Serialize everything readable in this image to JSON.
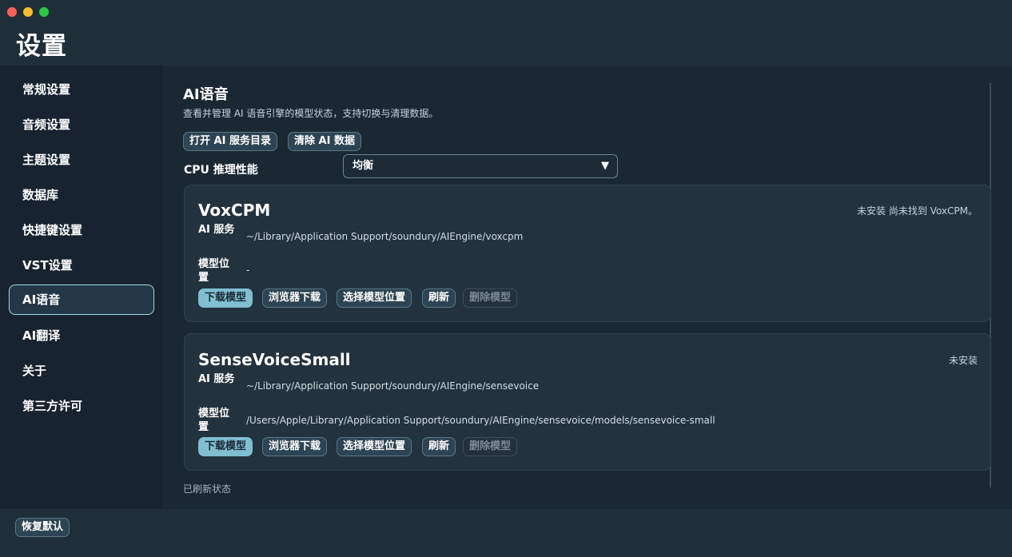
{
  "window": {
    "title": "设置"
  },
  "sidebar": {
    "items": [
      {
        "label": "常规设置"
      },
      {
        "label": "音频设置"
      },
      {
        "label": "主题设置"
      },
      {
        "label": "数据库"
      },
      {
        "label": "快捷键设置"
      },
      {
        "label": "VST设置"
      },
      {
        "label": "AI语音",
        "active": true
      },
      {
        "label": "AI翻译"
      },
      {
        "label": "关于"
      },
      {
        "label": "第三方许可"
      }
    ]
  },
  "section": {
    "title": "AI语音",
    "description": "查看并管理 AI 语音引擎的模型状态，支持切换与清理数据。",
    "open_dir_label": "打开 AI 服务目录",
    "clear_data_label": "清除 AI 数据",
    "cpu_label": "CPU 推理性能",
    "cpu_value": "均衡"
  },
  "cards": [
    {
      "name": "VoxCPM",
      "status": "未安装 尚未找到 VoxCPM。",
      "service_label": "AI 服务",
      "service_path": "~/Library/Application Support/soundury/AIEngine/voxcpm",
      "model_label": "模型位置",
      "model_path": "-"
    },
    {
      "name": "SenseVoiceSmall",
      "status": "未安装",
      "service_label": "AI 服务",
      "service_path": "~/Library/Application Support/soundury/AIEngine/sensevoice",
      "model_label": "模型位置",
      "model_path": "/Users/Apple/Library/Application Support/soundury/AIEngine/sensevoice/models/sensevoice-small"
    }
  ],
  "card_actions": {
    "download": "下载模型",
    "browser_download": "浏览器下载",
    "choose_location": "选择模型位置",
    "refresh": "刷新",
    "delete": "删除模型"
  },
  "status_message": "已刷新状态",
  "footer": {
    "restore_label": "恢复默认"
  },
  "colors": {
    "accent": "#7fbfd0",
    "background": "#1a2833",
    "sidebar": "#172330"
  }
}
